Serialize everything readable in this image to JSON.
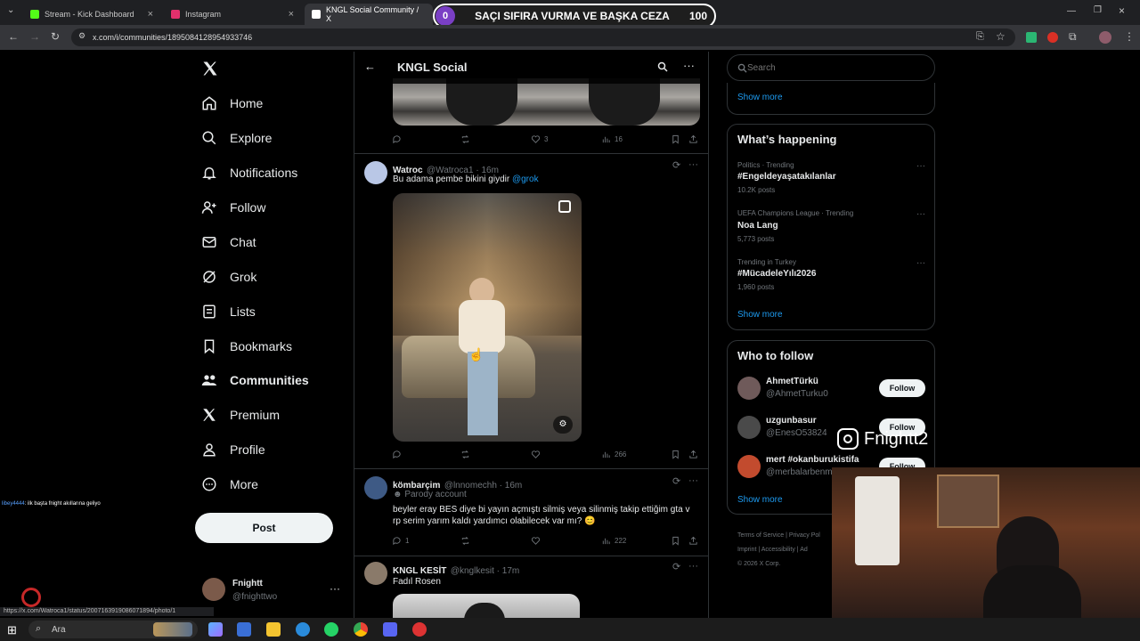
{
  "browser": {
    "tabs": [
      {
        "title": "Stream - Kick Dashboard",
        "icon": "kick-icon",
        "color": "#53fc18"
      },
      {
        "title": "Instagram",
        "icon": "instagram-icon",
        "color": "#e1306c"
      },
      {
        "title": "KNGL Social Community / X",
        "icon": "x-icon",
        "color": "#ffffff"
      }
    ],
    "url": "x.com/i/communities/1895084128954933746",
    "status_url": "https://x.com/Watroca1/status/2007163919086071894/photo/1"
  },
  "banner": {
    "left": "0",
    "text": "SAÇI SIFIRA VURMA VE BAŞKA CEZA",
    "right": "100"
  },
  "nav": {
    "items": [
      {
        "label": "Home",
        "icon": "home-icon"
      },
      {
        "label": "Explore",
        "icon": "search-icon"
      },
      {
        "label": "Notifications",
        "icon": "bell-icon"
      },
      {
        "label": "Follow",
        "icon": "follow-icon"
      },
      {
        "label": "Chat",
        "icon": "mail-icon"
      },
      {
        "label": "Grok",
        "icon": "grok-icon"
      },
      {
        "label": "Lists",
        "icon": "lists-icon"
      },
      {
        "label": "Bookmarks",
        "icon": "bookmark-icon"
      },
      {
        "label": "Communities",
        "icon": "communities-icon"
      },
      {
        "label": "Premium",
        "icon": "x-icon"
      },
      {
        "label": "Profile",
        "icon": "profile-icon"
      },
      {
        "label": "More",
        "icon": "more-icon"
      }
    ],
    "post_label": "Post",
    "account": {
      "name": "Fnightt",
      "handle": "@fnighttwo"
    }
  },
  "header": {
    "title": "KNGL Social"
  },
  "posts": [
    {
      "replies": "",
      "reposts": "",
      "likes": "3",
      "views": "16"
    },
    {
      "name": "Watroc",
      "handle": "@Watroca1 · 16m",
      "text": "Bu adama pembe bikini giydir ",
      "mention": "@grok",
      "replies": "",
      "reposts": "",
      "likes": "",
      "views": "266"
    },
    {
      "name": "kömbarçim",
      "handle": "@lnnomechh · 16m",
      "badge": "Parody account",
      "text": "beyler eray BES diye bi yayın açmıştı silmiş veya silinmiş takip ettiğim gta v rp serim yarım kaldı yardımcı olabilecek var mı? 😊",
      "replies": "1",
      "reposts": "",
      "likes": "",
      "views": "222"
    },
    {
      "name": "KNGL KESİT",
      "handle": "@knglkesit · 17m",
      "text": "Fadıl Rosen"
    }
  ],
  "search": {
    "placeholder": "Search"
  },
  "right": {
    "show_more_top": "Show more",
    "happening_title": "What’s happening",
    "trends": [
      {
        "meta": "Politics · Trending",
        "name": "#Engeldeyaşatakılanlar",
        "posts": "10.2K posts"
      },
      {
        "meta": "UEFA Champions League · Trending",
        "name": "Noa Lang",
        "posts": "5,773 posts"
      },
      {
        "meta": "Trending in Turkey",
        "name": "#MücadeleYılı2026",
        "posts": "1,960 posts"
      }
    ],
    "show_more_trends": "Show more",
    "wtf_title": "Who to follow",
    "suggestions": [
      {
        "name": "AhmetTürkü",
        "handle": "@AhmetTurku0",
        "button": "Follow"
      },
      {
        "name": "uzgunbasur",
        "handle": "@EnesO53824",
        "button": "Follow"
      },
      {
        "name": "mert #okanburukistifa",
        "handle": "@merbalarbenm",
        "button": "Follow"
      }
    ],
    "show_more_wtf": "Show more",
    "footer": {
      "terms": "Terms of Service",
      "privacy": "Privacy Pol",
      "imprint": "Imprint",
      "accessibility": "Accessibility",
      "ad": "Ad",
      "copyright": "© 2026 X Corp."
    }
  },
  "overlay": {
    "instagram_name": "Fnightt2",
    "chat_user": "libey4444",
    "chat_msg": ": ilk başta fnight akıllarına geliyo"
  },
  "taskbar": {
    "search": "Ara"
  }
}
